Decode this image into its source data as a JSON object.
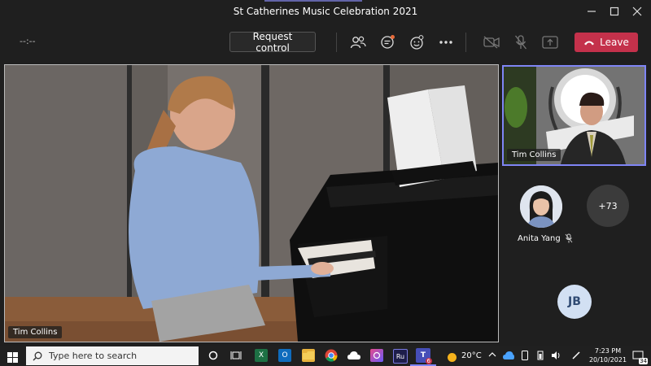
{
  "window": {
    "title": "St Catherines Music Celebration 2021"
  },
  "toolbar": {
    "timer": "--:--",
    "request_control_label": "Request control",
    "leave_label": "Leave"
  },
  "main_video": {
    "speaker_name": "Tim Collins"
  },
  "side_video": {
    "speaker_name": "Tim Collins"
  },
  "participants": [
    {
      "name": "Anita Yang",
      "muted": true
    },
    {
      "overflow_count": "+73"
    },
    {
      "initials": "JB"
    }
  ],
  "taskbar": {
    "search_placeholder": "Type here to search",
    "teams_badge": "6",
    "weather": "20°C",
    "time": "7:23 PM",
    "date": "20/10/2021",
    "notification_count": "34"
  },
  "colors": {
    "leave": "#c4314b",
    "accent": "#6264a7",
    "active_border": "#7f85f5"
  }
}
